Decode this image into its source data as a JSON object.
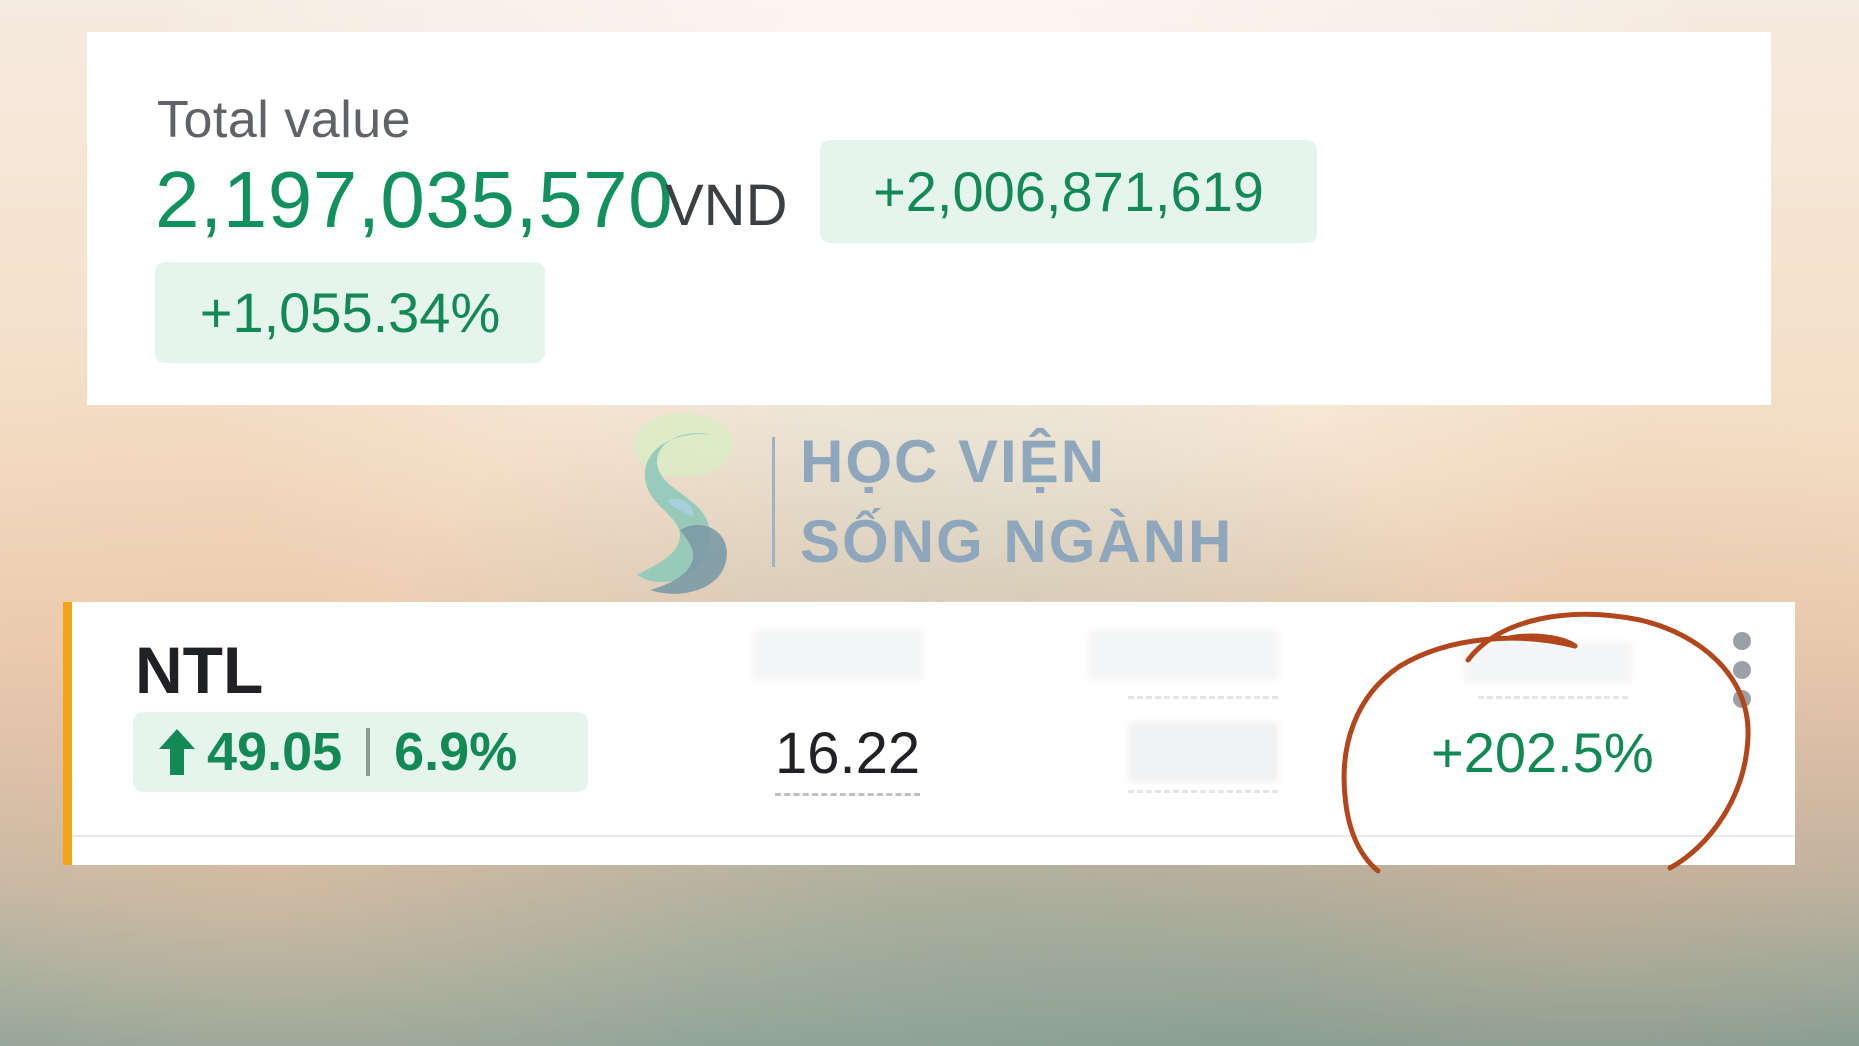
{
  "summary": {
    "label": "Total value",
    "amount": "2,197,035,570",
    "currency": "VND",
    "change_absolute": "+2,006,871,619",
    "change_percent": "+1,055.34%"
  },
  "watermark": {
    "line1": "HỌC VIỆN",
    "line2": "SỐNG NGÀNH",
    "logo_icon": "s-swirl-logo"
  },
  "holding": {
    "ticker": "NTL",
    "direction_icon": "up-arrow-icon",
    "change_value": "49.05",
    "change_percent": "6.9%",
    "price": "16.22",
    "gain_percent": "+202.5%",
    "menu_icon": "more-vert-icon"
  },
  "colors": {
    "positive_green": "#138a55",
    "positive_bg": "#e5f4ec",
    "accent_orange": "#f4a417",
    "annotation_red": "#b2461c"
  }
}
